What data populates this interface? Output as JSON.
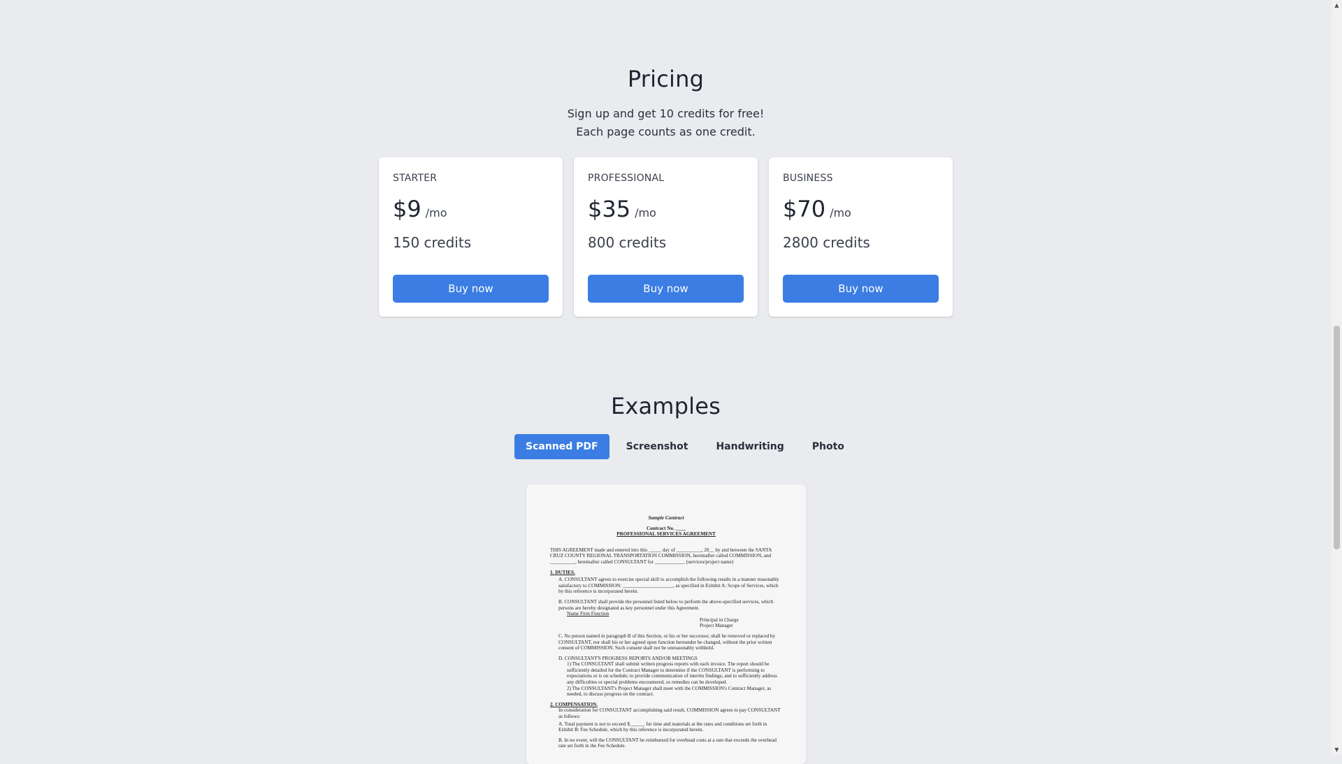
{
  "pricing": {
    "title": "Pricing",
    "subtitle_line1": "Sign up and get 10 credits for free!",
    "subtitle_line2": "Each page counts as one credit.",
    "plans": [
      {
        "name": "STARTER",
        "price": "$9",
        "period": "/mo",
        "credits": "150 credits",
        "button": "Buy now"
      },
      {
        "name": "PROFESSIONAL",
        "price": "$35",
        "period": "/mo",
        "credits": "800 credits",
        "button": "Buy now"
      },
      {
        "name": "BUSINESS",
        "price": "$70",
        "period": "/mo",
        "credits": "2800 credits",
        "button": "Buy now"
      }
    ]
  },
  "examples": {
    "title": "Examples",
    "tabs": [
      "Scanned PDF",
      "Screenshot",
      "Handwriting",
      "Photo"
    ],
    "active_tab": "Scanned PDF",
    "document": {
      "heading": "Sample Contract",
      "contract_no": "Contract No. ____",
      "agreement_title": "PROFESSIONAL SERVICES AGREEMENT",
      "intro": "THIS AGREEMENT made and entered into this _____ day of __________, 20__ by and between the SANTA CRUZ COUNTY REGIONAL TRANSPORTATION COMMISSION, hereinafter called COMMISSION, and __________, hereinafter called CONSULTANT for ____________ (services/project name)",
      "s1_title": "1.   DUTIES.",
      "s1_a": "A.   CONSULTANT agrees to exercise special skill to accomplish the following results in a manner reasonably satisfactory to COMMISSION: ____________________, as specified in Exhibit A: Scope of Services, which by this reference is incorporated herein.",
      "s1_b": "B.   CONSULTANT shall provide the personnel listed below to perform the above-specified services, which persons are hereby designated as key personnel under this Agreement.",
      "s1_b_cols": "Name                    Firm                    Function",
      "s1_b_roles1": "Principal in Charge",
      "s1_b_roles2": "Project Manager",
      "s1_c": "C.   No person named in paragraph B of this Section, or his or her successor, shall be removed or replaced by CONSULTANT, nor shall his or her agreed upon function hereunder be changed, without the prior written consent of COMMISSION.  Such consent shall not be unreasonably withheld.",
      "s1_d": "D.   CONSULTANT'S PROGRESS REPORTS AND/OR MEETINGS",
      "s1_d1": "1)   The CONSULTANT shall submit written progress reports with each invoice. The report should be sufficiently detailed for the Contract Manager to determine if the CONSULTANT is performing to expectations or is on schedule; to provide communication of interim findings; and to sufficiently address any difficulties or special problems encountered, so remedies can be developed.",
      "s1_d2": "2)   The CONSULTANT's Project Manager shall meet with the COMMISSION's Contract Manager, as needed, to discuss progress on the contract.",
      "s2_title": "2.   COMPENSATION.",
      "s2_intro": "In consideration for CONSULTANT accomplishing said result, COMMISSION agrees to pay CONSULTANT as follows:",
      "s2_a": "A.   Total payment is not to exceed $______ for time and materials at the rates and conditions set forth in Exhibit B: Fee Schedule, which by this reference is incorporated herein.",
      "s2_b": "B.   In no event, will the CONSULTANT be reimbursed for overhead costs at a rate that exceeds the overhead rate set forth in the Fee Schedule."
    }
  }
}
